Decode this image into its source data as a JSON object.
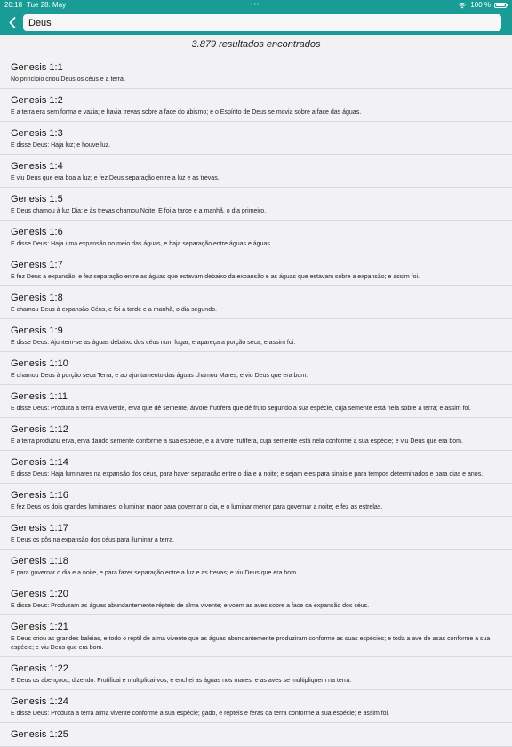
{
  "status": {
    "time": "20:18",
    "date": "Tue 28. May",
    "dots": "•••",
    "battery": "100 %",
    "battery_level": 1.0
  },
  "nav": {
    "search_value": "Deus"
  },
  "results_count": "3.879 resultados encontrados",
  "results": [
    {
      "ref": "Genesis 1:1",
      "text": "No princípio criou Deus os céus e a terra."
    },
    {
      "ref": "Genesis 1:2",
      "text": "E a terra era sem forma e vazia; e havia trevas sobre a face do abismo; e o Espírito de Deus se movia sobre a face das águas."
    },
    {
      "ref": "Genesis 1:3",
      "text": "E disse Deus: Haja luz; e houve luz."
    },
    {
      "ref": "Genesis 1:4",
      "text": "E viu Deus que era boa a luz; e fez Deus separação entre a luz e as trevas."
    },
    {
      "ref": "Genesis 1:5",
      "text": "E Deus chamou à luz Dia; e às trevas chamou Noite. E foi a tarde e a manhã, o dia primeiro."
    },
    {
      "ref": "Genesis 1:6",
      "text": "E disse Deus: Haja uma expansão no meio das águas, e haja separação entre águas e águas."
    },
    {
      "ref": "Genesis 1:7",
      "text": "E fez Deus a expansão, e fez separação entre as águas que estavam debaixo da expansão e as águas que estavam sobre a expansão; e assim foi."
    },
    {
      "ref": "Genesis 1:8",
      "text": "E chamou Deus à expansão Céus, e foi a tarde e a manhã, o dia segundo."
    },
    {
      "ref": "Genesis 1:9",
      "text": "E disse Deus: Ajuntem-se as águas debaixo dos céus num lugar; e apareça a porção seca; e assim foi."
    },
    {
      "ref": "Genesis 1:10",
      "text": "E chamou Deus à porção seca Terra; e ao ajuntamento das águas chamou Mares; e viu Deus que era bom."
    },
    {
      "ref": "Genesis 1:11",
      "text": "E disse Deus: Produza a terra erva verde, erva que dê semente, árvore frutífera que dê fruto segundo a sua espécie, cuja semente está nela sobre a terra; e assim foi."
    },
    {
      "ref": "Genesis 1:12",
      "text": "E a terra produziu erva, erva dando semente conforme a sua espécie, e a árvore frutífera, cuja semente está nela conforme a sua espécie; e viu Deus que era bom."
    },
    {
      "ref": "Genesis 1:14",
      "text": "E disse Deus: Haja luminares na expansão dos céus, para haver separação entre o dia e a noite; e sejam eles para sinais e para tempos determinados e para dias e anos."
    },
    {
      "ref": "Genesis 1:16",
      "text": "E fez Deus os dois grandes luminares: o luminar maior para governar o dia, e o luminar menor para governar a noite; e fez as estrelas."
    },
    {
      "ref": "Genesis 1:17",
      "text": "E Deus os pôs na expansão dos céus para iluminar a terra,"
    },
    {
      "ref": "Genesis 1:18",
      "text": "E para governar o dia e a noite, e para fazer separação entre a luz e as trevas; e viu Deus que era bom."
    },
    {
      "ref": "Genesis 1:20",
      "text": "E disse Deus: Produzam as águas abundantemente répteis de alma vivente; e voem as aves sobre a face da expansão dos céus."
    },
    {
      "ref": "Genesis 1:21",
      "text": "E Deus criou as grandes baleias, e todo o réptil de alma vivente que as águas abundantemente produziram conforme as suas espécies; e toda a ave de asas conforme a sua espécie; e viu Deus que era bom."
    },
    {
      "ref": "Genesis 1:22",
      "text": "E Deus os abençoou, dizendo: Frutificai e multiplicai-vos, e enchei as águas nos mares; e as aves se multipliquem na terra."
    },
    {
      "ref": "Genesis 1:24",
      "text": "E disse Deus: Produza a terra alma vivente conforme a sua espécie; gado, e répteis e feras da terra conforme a sua espécie; e assim foi."
    },
    {
      "ref": "Genesis 1:25",
      "text": ""
    }
  ],
  "colors": {
    "accent": "#1a9c96",
    "background": "#f2f2f4"
  }
}
